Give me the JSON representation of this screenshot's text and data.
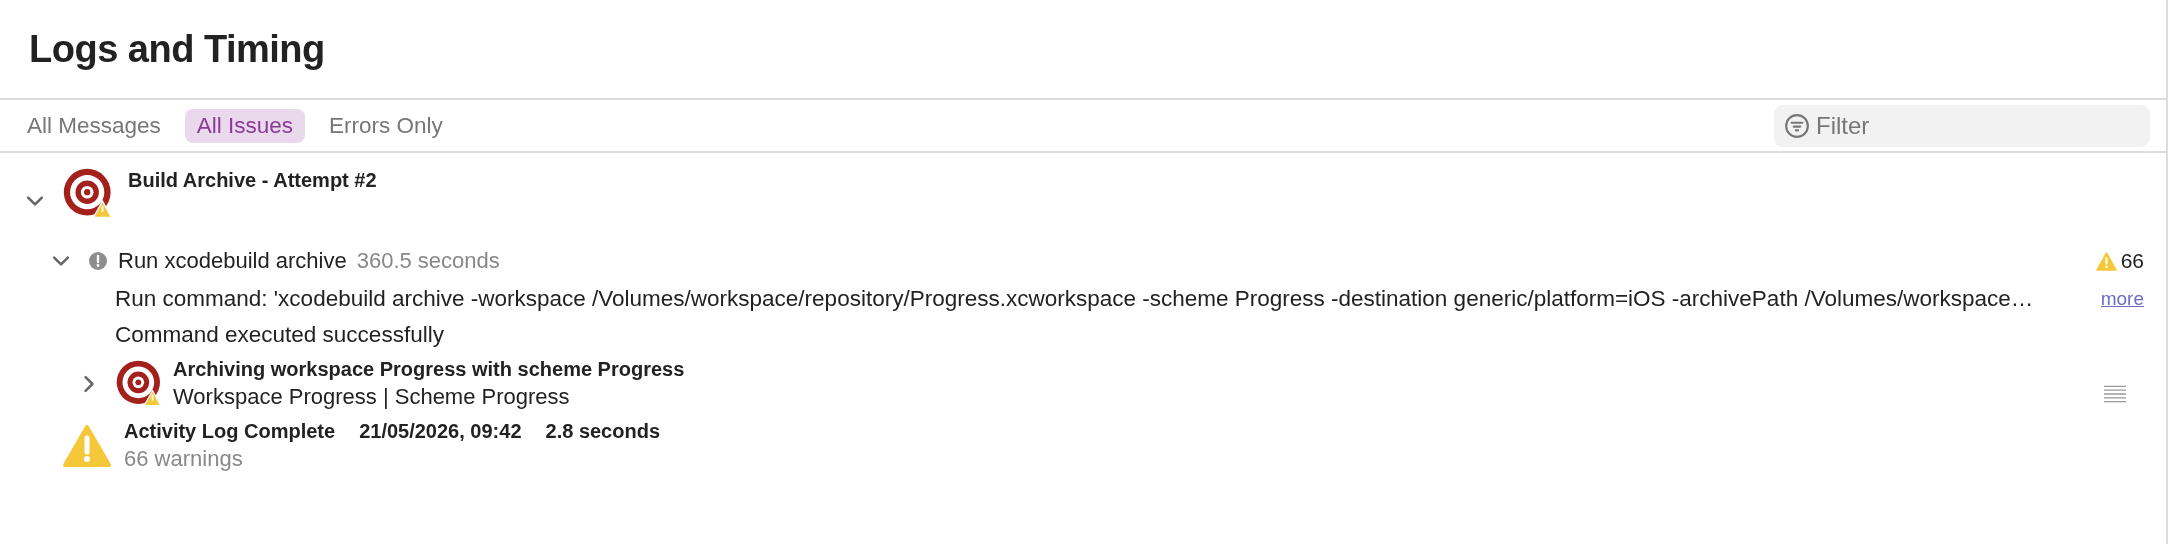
{
  "title": "Logs and Timing",
  "tabs": [
    {
      "label": "All Messages",
      "selected": false
    },
    {
      "label": "All Issues",
      "selected": true
    },
    {
      "label": "Errors Only",
      "selected": false
    }
  ],
  "filter": {
    "placeholder": "Filter"
  },
  "log": {
    "title": "Build Archive - Attempt #2",
    "expanded": true,
    "steps": [
      {
        "title": "Run xcodebuild archive",
        "duration": "360.5 seconds",
        "expanded": true,
        "warning_count": "66",
        "command": "Run command: 'xcodebuild archive -workspace /Volumes/workspace/repository/Progress.xcworkspace -scheme Progress -destination generic/platform=iOS -archivePath /Volumes/workspace…",
        "more": "more",
        "result": "Command executed successfully",
        "children": [
          {
            "title": "Archiving workspace Progress with scheme Progress",
            "subtitle": "Workspace Progress | Scheme Progress",
            "expanded": false
          }
        ]
      }
    ]
  },
  "summary": {
    "title": "Activity Log Complete",
    "date": "21/05/2026, 09:42",
    "duration": "2.8 seconds",
    "warnings": "66 warnings"
  }
}
